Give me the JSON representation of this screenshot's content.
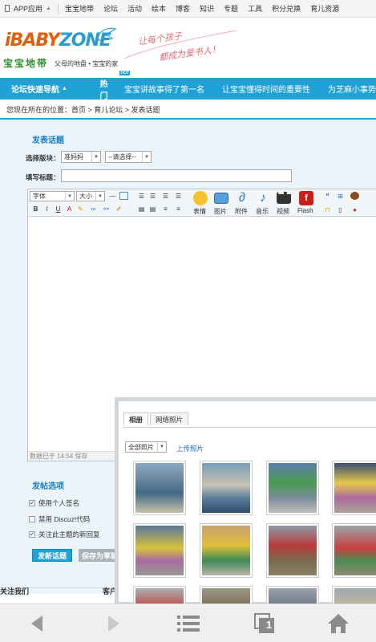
{
  "topbar": {
    "app": "APP应用",
    "links": [
      "宝宝地带",
      "论坛",
      "活动",
      "绘本",
      "博客",
      "知识",
      "专题",
      "工具",
      "积分兑换",
      "育儿资源"
    ]
  },
  "logo": {
    "brand_a": "iBABY",
    "brand_b": "ZONE",
    "cn": "宝宝地带",
    "tagline": "父母的地盘 • 宝宝的家",
    "slogan1": "让每个孩子",
    "slogan2": "都成为爱书人！"
  },
  "nav": {
    "quick": "论坛快速导航",
    "hot": "热门",
    "hot_badge": "HOT",
    "items": [
      "宝宝讲故事得了第一名",
      "让宝宝懂得时间的重要性",
      "为芝麻小事势"
    ]
  },
  "breadcrumb": "您现在所在的位置：首页 > 育儿论坛 > 发表话题",
  "post": {
    "title": "发表话题",
    "section_label": "选择版块：",
    "section_value": "准妈妈",
    "section_select2": "--请选择--",
    "title_label": "填写标题：",
    "toolbar": {
      "font": "字体",
      "size": "大小",
      "emoji": "表情",
      "image": "图片",
      "attach": "附件",
      "music": "音乐",
      "video": "视频",
      "flash": "Flash"
    },
    "autosave": "数据已于 14:54 保存"
  },
  "options": {
    "title": "发帖选项",
    "items": [
      {
        "label": "使用个人签名",
        "checked": true
      },
      {
        "label": "禁用 Discuz!代码",
        "checked": false
      },
      {
        "label": "关注此主题的新回复",
        "checked": true
      }
    ],
    "post_button": "发新话题",
    "save_button": "保存为草稿"
  },
  "footer": {
    "left": "关注我们",
    "right": "客户"
  },
  "popup": {
    "tab_album": "相册",
    "tab_web": "网络照片",
    "filter": "全部照片",
    "upload": "上传照片"
  },
  "colors": {
    "accent": "#1fa3d6",
    "link": "#1a6ec5"
  },
  "bottom_nav": {
    "icons": [
      "back-arrow-icon",
      "forward-arrow-icon",
      "menu-icon",
      "tabs-icon",
      "home-icon"
    ],
    "tab_count": "1"
  }
}
